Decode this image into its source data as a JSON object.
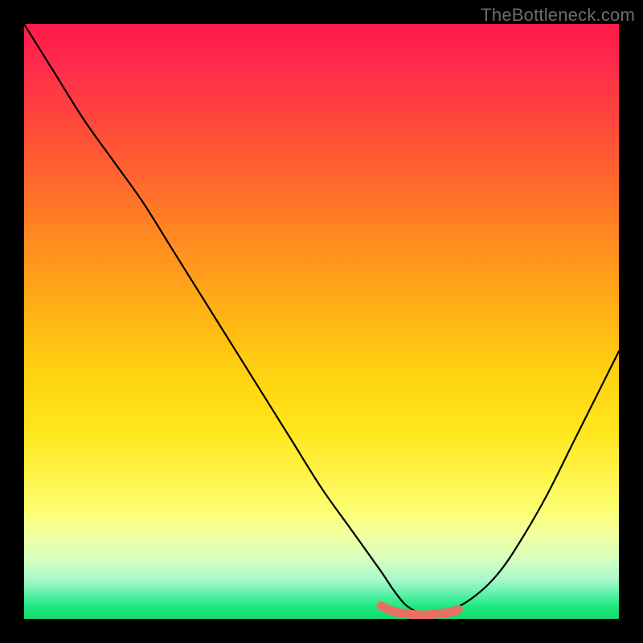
{
  "watermark": "TheBottleneck.com",
  "chart_data": {
    "type": "line",
    "title": "",
    "xlabel": "",
    "ylabel": "",
    "xlim": [
      0,
      100
    ],
    "ylim": [
      0,
      100
    ],
    "grid": false,
    "legend": false,
    "notes": "Black V-shaped bottleneck curve over a vertical rainbow heat gradient (red=high bottleneck, green=optimal). Short coral segment marks the optimal zone at the curve's minimum.",
    "series": [
      {
        "name": "bottleneck-curve",
        "color": "#000000",
        "x": [
          0,
          5,
          10,
          15,
          20,
          25,
          30,
          35,
          40,
          45,
          50,
          55,
          60,
          62,
          64,
          66,
          68,
          70,
          72,
          76,
          80,
          84,
          88,
          92,
          96,
          100
        ],
        "values": [
          100,
          92,
          84,
          77,
          70,
          62,
          54,
          46,
          38,
          30,
          22,
          15,
          8,
          5,
          2.5,
          1.2,
          0.8,
          1.0,
          1.5,
          4,
          8,
          14,
          21,
          29,
          37,
          45
        ]
      },
      {
        "name": "optimal-zone",
        "color": "#e96f63",
        "x": [
          60,
          62,
          64,
          66,
          68,
          70,
          72,
          73
        ],
        "values": [
          2.2,
          1.3,
          0.9,
          0.7,
          0.7,
          0.9,
          1.2,
          1.6
        ]
      }
    ]
  }
}
